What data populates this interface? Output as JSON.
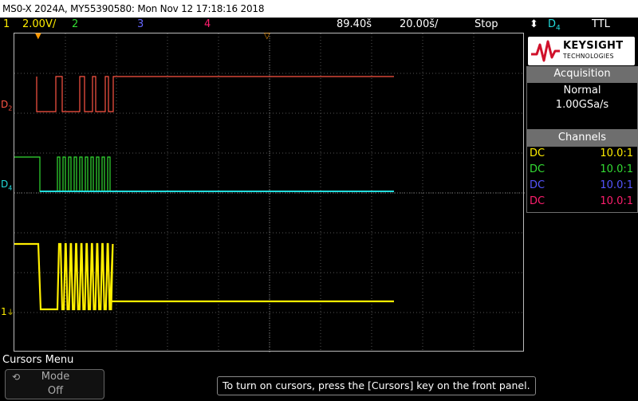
{
  "titlebar": {
    "text": "MS0-X 2024A, MY55390580: Mon Nov 12 17:18:16 2018"
  },
  "status": {
    "ch1_num": "1",
    "ch1_scale": "2.00V/",
    "ch2_num": "2",
    "ch3_num": "3",
    "ch4_num": "4",
    "timebase_delay": "89.40š",
    "timebase_scale": "20.00š/",
    "run_state": "Stop",
    "trigger_source": "D",
    "trigger_source_sub": "4",
    "trigger_level": "TTL"
  },
  "logo": {
    "brand": "KEYSIGHT",
    "tagline": "TECHNOLOGIES"
  },
  "acquisition": {
    "header": "Acquisition",
    "mode": "Normal",
    "rate": "1.00GSa/s"
  },
  "channels": {
    "header": "Channels",
    "rows": [
      {
        "coupling": "DC",
        "probe": "10.0:1",
        "color": "#ffee00"
      },
      {
        "coupling": "DC",
        "probe": "10.0:1",
        "color": "#33dd33"
      },
      {
        "coupling": "DC",
        "probe": "10.0:1",
        "color": "#5555ff"
      },
      {
        "coupling": "DC",
        "probe": "10.0:1",
        "color": "#ff1e6e"
      }
    ]
  },
  "traces": {
    "d2_label": "D",
    "d2_sub": "2",
    "d4_label": "D",
    "d4_sub": "4",
    "ch1_marker": "1",
    "colors": {
      "d2": "#ff5544",
      "d4_high": "#33dd33",
      "d4_low": "#22dddd",
      "ch1": "#ffee00",
      "grid": "#555555"
    }
  },
  "bottom": {
    "menu_title": "Cursors Menu",
    "mode_label": "Mode",
    "mode_value": "Off",
    "hint": "To turn on cursors, press the [Cursors] key on the front panel."
  }
}
